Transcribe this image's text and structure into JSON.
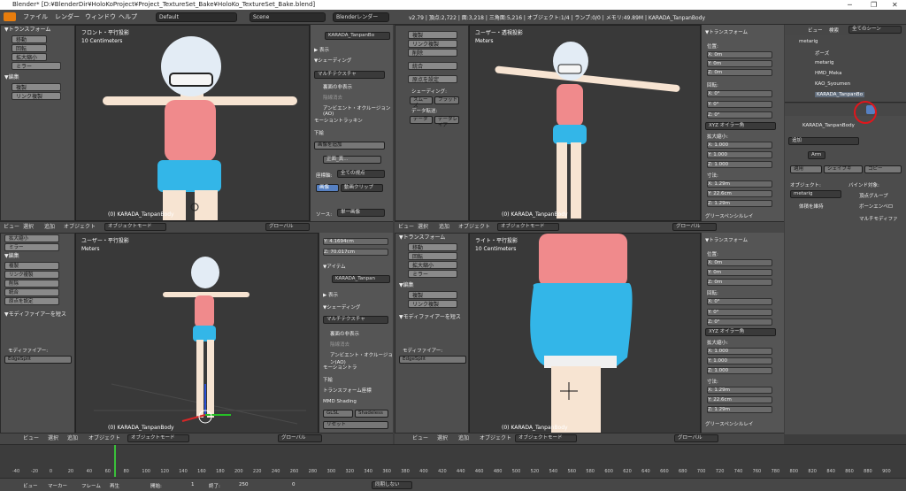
{
  "window": {
    "title": "Blender* [D:¥BlenderDir¥HoloKoProject¥Project_TextureSet_Bake¥HoloKo_TextureSet_Bake.blend]"
  },
  "menubar": {
    "file": "ファイル",
    "render": "レンダー",
    "window": "ウィンドウ",
    "help": "ヘルプ",
    "layout": "Default",
    "scene": "Scene",
    "engine": "Blenderレンダー",
    "stats": "v2.79 | 頂点:2,722 | 面:3,218 | 三角面:5,216 | オブジェクト:1/4 | ランプ:0/0 | メモリ:49.89M | KARADA_TanpanBody"
  },
  "left_tools": {
    "transform_header": "▼トランスフォーム",
    "move": "移動",
    "rotate": "回転",
    "scale": "拡大縮小",
    "mirror": "ミラー",
    "edit_header": "▼編集",
    "duplicate": "複製",
    "link_duplicate": "リンク複製",
    "delete": "削除",
    "join": "統合",
    "origin": "原点を設定",
    "shading_label": "シェーディング:",
    "smooth": "スムーズ",
    "flat": "フラット",
    "data_transfer": "データ転送:",
    "data": "データ",
    "data_layout": "データレイア",
    "modifier_header": "▼モディファイアーを短ス",
    "modifier_label": "モディファイアー:",
    "edgesplit": "EdgeSplit"
  },
  "viewports": {
    "front": {
      "title": "フロント・平行投影",
      "units": "10 Centimeters",
      "object": "(0) KARADA_TanpanBody"
    },
    "user_persp": {
      "title": "ユーザー・透視投影",
      "units": "Meters",
      "object": "(0) KARADA_TanpanBody"
    },
    "user_ortho": {
      "title": "ユーザー・平行投影",
      "units": "Meters",
      "object": "(0) KARADA_TanpanBody"
    },
    "right": {
      "title": "ライト・平行投影",
      "units": "10 Centimeters",
      "object": "(0) KARADA_TanpanBody"
    }
  },
  "viewport_header": {
    "view": "ビュー",
    "select": "選択",
    "add": "追加",
    "object": "オブジェクト",
    "mode": "オブジェクトモード",
    "orientation": "グローバル"
  },
  "npanel_tl": {
    "item_name": "KARADA_TanpanBo",
    "display": "▶ 表示",
    "shading": "▼シェーディング",
    "matcap": "マルチテクスチャ",
    "backface": "裏面の非表示",
    "hidden_wire": "陰線消去",
    "ao": "アンビエント・オクルージョン(AO)",
    "motion_tracking": "モーショントラッキン",
    "background": "下絵",
    "add_image": "画像を追加",
    "image_name": "正面_真...",
    "axis_label": "座標軸:",
    "axis_val": "全ての視点",
    "image_btn": "画像",
    "movie_btn": "動画クリップ",
    "source_label": "ソース:",
    "source_val": "単一画像"
  },
  "npanel_tr": {
    "transform_header": "▼トランスフォーム",
    "location": "位置:",
    "rotation": "回転:",
    "rot_mode": "XYZ オイラー角",
    "scale": "拡大縮小:",
    "dimensions": "寸法:",
    "loc": [
      "X:  0m",
      "Y:  0m",
      "Z:  0m"
    ],
    "rot": [
      "X:  0°",
      "Y:  0°",
      "Z:  0°"
    ],
    "scl": [
      "X:  1.000",
      "Y:  1.000",
      "Z:  1.000"
    ],
    "dim": [
      "X:  1.29m",
      "Y:  22.6cm",
      "Z:  1.29m"
    ],
    "grease": "グリースペンシルレイ"
  },
  "npanel_bl": {
    "ycoord": "Y:  4.1694cm",
    "zcoord": "Z:  70.017cm",
    "item_header": "▼アイテム",
    "item_name": "KARADA_Tanpan",
    "display": "▶ 表示",
    "shading": "▼シェーディング",
    "matcap": "マルチテクスチャ",
    "backface": "裏面の非表示",
    "hidden_wire": "陰線消去",
    "ao": "アンビエント・オクルージョン(AO)",
    "motion_tracking": "モーショントラ",
    "background": "下絵",
    "transform_orient": "トランスフォーム座標",
    "mmd": "MMD Shading",
    "glsl": "GLSL",
    "shadeless": "Shadeless",
    "reset": "リセット"
  },
  "outliner": {
    "view": "ビュー",
    "search": "検索",
    "scope": "全てのシーン",
    "items": [
      "metarig",
      "ポーズ",
      "metarig",
      "HMD_Meka",
      "KAO_Syoumen",
      "KARADA_TanpanBo"
    ]
  },
  "properties": {
    "object_name": "KARADA_TanpanBody",
    "add": "追加",
    "mod_name": "Arm",
    "apply": "適用",
    "apply_shape": "シェイプキ",
    "copy": "コピー",
    "object_label": "オブジェクト:",
    "bind_label": "バインド対象:",
    "target": "metarig",
    "preserve_volume": "体積を維持",
    "vertex_groups": "頂点グループ",
    "bone_envelopes": "ボーンエンベロ",
    "multi_modifier": "マルチモディファ"
  },
  "timeline": {
    "ticks": [
      "-40",
      "-20",
      "0",
      "20",
      "40",
      "60",
      "80",
      "100",
      "120",
      "140",
      "160",
      "180",
      "200",
      "220",
      "240",
      "260",
      "280",
      "300",
      "320",
      "340",
      "360",
      "380",
      "400",
      "420",
      "440",
      "460",
      "480",
      "500",
      "520",
      "540",
      "560",
      "580",
      "600",
      "620",
      "640",
      "660",
      "680",
      "700",
      "720",
      "740",
      "760",
      "780",
      "800",
      "820",
      "840",
      "860",
      "880",
      "900"
    ],
    "view": "ビュー",
    "marker": "マーカー",
    "frame": "フレーム",
    "playback": "再生",
    "start": "開始:",
    "start_val": "1",
    "end": "終了:",
    "end_val": "250",
    "current": "0",
    "sync": "同期しない"
  },
  "colors": {
    "bg": "#3d3d3d",
    "viewport": "#393939",
    "panel": "#515151",
    "hair": "#e3ecf5",
    "top": "#f08a8c",
    "shorts": "#33b6e8",
    "skin": "#f7e4d2",
    "highlight": "#e0161c",
    "active_blue": "#5680c2"
  }
}
